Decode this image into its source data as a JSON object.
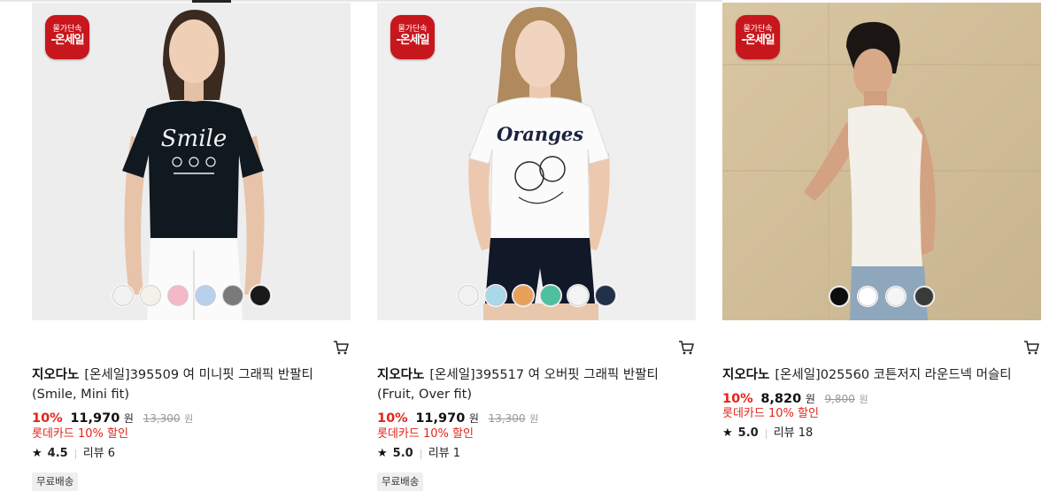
{
  "badge": {
    "line1": "물가단속",
    "line2": "-온세일"
  },
  "colors": {
    "accent_red": "#e1251b",
    "badge_red": "#c8161d"
  },
  "products": [
    {
      "brand": "지오다노",
      "name": "[온세일]395509 여 미니핏 그래픽 반팔티 (Smile, Mini fit)",
      "discount_rate": "10%",
      "price": "11,970",
      "currency": "원",
      "original_price": "13,300",
      "card_discount": "롯데카드 10% 할인",
      "rating": "4.5",
      "reviews": "리뷰 6",
      "shipping": "무료배송",
      "swatch_colors": [
        "#f2f2f2",
        "#f4f1e8",
        "#f3b9c8",
        "#b8d0ea",
        "#7a7a7a",
        "#1a1a1a"
      ]
    },
    {
      "brand": "지오다노",
      "name": "[온세일]395517 여 오버핏 그래픽 반팔티 (Fruit, Over fit)",
      "discount_rate": "10%",
      "price": "11,970",
      "currency": "원",
      "original_price": "13,300",
      "card_discount": "롯데카드 10% 할인",
      "rating": "5.0",
      "reviews": "리뷰 1",
      "shipping": "무료배송",
      "swatch_colors": [
        "#f2f2f2",
        "#a9d8e8",
        "#e8a15a",
        "#4cc0a0",
        "#f4f4f4",
        "#22304a"
      ]
    },
    {
      "brand": "지오다노",
      "name": "[온세일]025560 코튼저지 라운드넥 머슬티",
      "discount_rate": "10%",
      "price": "8,820",
      "currency": "원",
      "original_price": "9,800",
      "card_discount": "롯데카드 10% 할인",
      "rating": "5.0",
      "reviews": "리뷰 18",
      "swatch_colors": [
        "#0d0d0d",
        "#ffffff",
        "#f5f5f5",
        "#3a3a3a"
      ]
    }
  ]
}
